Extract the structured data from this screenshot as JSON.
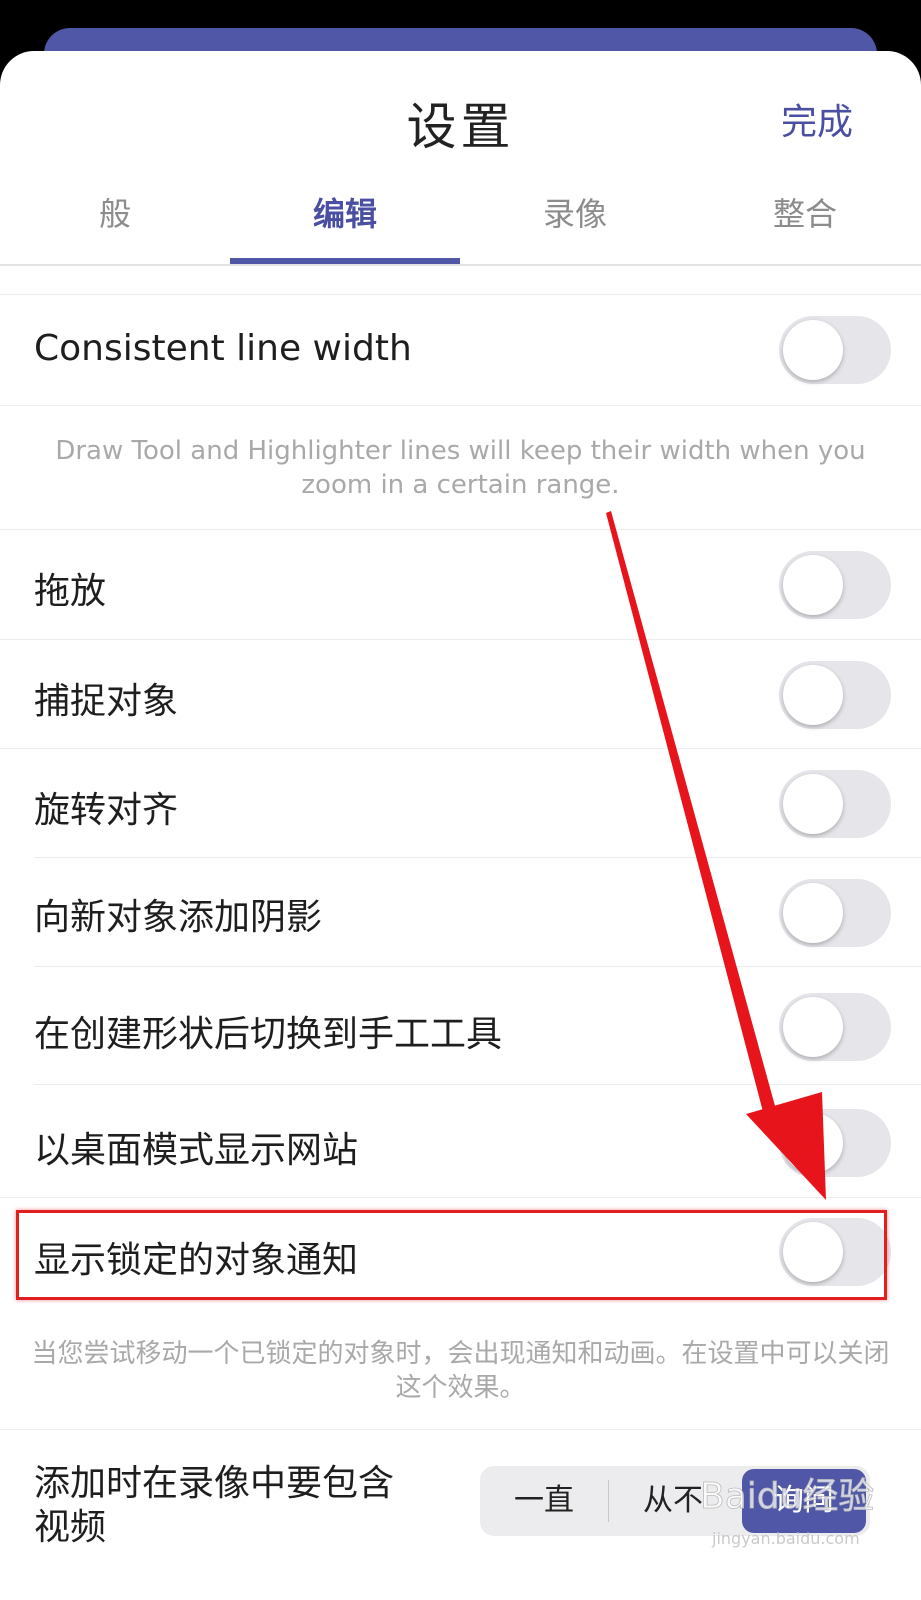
{
  "header": {
    "title": "设置",
    "done_label": "完成"
  },
  "tabs": [
    {
      "label": "般",
      "active": false
    },
    {
      "label": "编辑",
      "active": true
    },
    {
      "label": "录像",
      "active": false
    },
    {
      "label": "整合",
      "active": false
    }
  ],
  "settings": {
    "consistent_line_width": {
      "label": "Consistent line width",
      "on": false
    },
    "consistent_line_width_note": "Draw Tool and Highlighter lines will keep their width when you zoom in a certain range.",
    "drag_drop": {
      "label": "拖放",
      "on": false
    },
    "snap_objects": {
      "label": "捕捉对象",
      "on": false
    },
    "rotate_align": {
      "label": "旋转对齐",
      "on": false
    },
    "add_shadow": {
      "label": "向新对象添加阴影",
      "on": false
    },
    "switch_hand_tool": {
      "label": "在创建形状后切换到手工工具",
      "on": false
    },
    "desktop_mode": {
      "label": "以桌面模式显示网站",
      "on": false
    },
    "locked_notice": {
      "label": "显示锁定的对象通知",
      "on": false
    },
    "locked_notice_note": "当您尝试移动一个已锁定的对象时，会出现通知和动画。在设置中可以关闭这个效果。",
    "include_video": {
      "label_line1": "添加时在录像中要包含",
      "label_line2": "视频",
      "options": [
        "一直",
        "从不",
        "询问"
      ],
      "selected": "询问"
    }
  },
  "annotation": {
    "highlight_color": "#e02020",
    "arrow_color": "#e8141c"
  },
  "watermark": {
    "text": "Baidu经验",
    "subtext": "jingyan.baidu.com"
  }
}
